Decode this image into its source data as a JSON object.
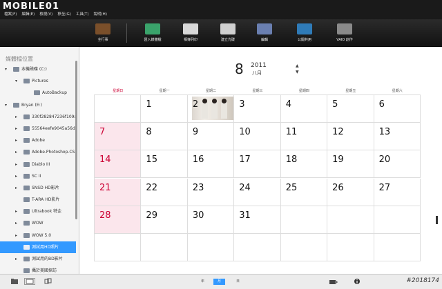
{
  "app": {
    "logo": "MOBILE01",
    "menu": [
      "檔案(F)",
      "編輯(E)",
      "檢視(V)",
      "移至(G)",
      "工具(T)",
      "說明(H)"
    ]
  },
  "toolbar": {
    "items": [
      {
        "label": "全行事",
        "icon": "calendar-view-icon",
        "color": "#7a4f2a"
      },
      {
        "label": "匯入媒體檔",
        "icon": "import-media-icon",
        "color": "#3aa36b"
      },
      {
        "label": "相簿列印",
        "icon": "printer-icon",
        "color": "#d8d8d8"
      },
      {
        "label": "建立光碟",
        "icon": "disc-icon",
        "color": "#cfcfcf"
      },
      {
        "label": "編輯",
        "icon": "edit-icon",
        "color": "#6a7fb0"
      },
      {
        "label": "公開共用",
        "icon": "globe-share-icon",
        "color": "#2f7bb8"
      },
      {
        "label": "VAIO 創作",
        "icon": "vaio-movie-icon",
        "color": "#8a8a8a"
      }
    ]
  },
  "sidebar": {
    "header": "媒體檔位置",
    "nodes": [
      {
        "label": "本機磁碟 (C:)",
        "depth": 0,
        "arrow": "▾",
        "selected": false
      },
      {
        "label": "Pictures",
        "depth": 1,
        "arrow": "▾",
        "selected": false
      },
      {
        "label": "AutoBackup",
        "depth": 2,
        "arrow": "",
        "selected": false
      },
      {
        "label": "Bryan (E:)",
        "depth": 0,
        "arrow": "▾",
        "selected": false
      },
      {
        "label": "330f282847236f109af",
        "depth": 1,
        "arrow": "▸",
        "selected": false
      },
      {
        "label": "55564eefe9045a56dd",
        "depth": 1,
        "arrow": "▸",
        "selected": false
      },
      {
        "label": "Adobe",
        "depth": 1,
        "arrow": "▸",
        "selected": false
      },
      {
        "label": "Adobe.Photoshop.CS3",
        "depth": 1,
        "arrow": "▸",
        "selected": false
      },
      {
        "label": "Diablo III",
        "depth": 1,
        "arrow": "▸",
        "selected": false
      },
      {
        "label": "SC II",
        "depth": 1,
        "arrow": "▸",
        "selected": false
      },
      {
        "label": "SNSD HD影片",
        "depth": 1,
        "arrow": "▸",
        "selected": false
      },
      {
        "label": "T-ARA HD影片",
        "depth": 1,
        "arrow": "",
        "selected": false
      },
      {
        "label": "Ultrabook 特企",
        "depth": 1,
        "arrow": "▸",
        "selected": false
      },
      {
        "label": "WOW",
        "depth": 1,
        "arrow": "▸",
        "selected": false
      },
      {
        "label": "WOW 5.0",
        "depth": 1,
        "arrow": "▸",
        "selected": false
      },
      {
        "label": "測試用HD照片",
        "depth": 1,
        "arrow": "",
        "selected": true
      },
      {
        "label": "測試用的BD影片",
        "depth": 1,
        "arrow": "▸",
        "selected": false
      },
      {
        "label": "攝於美國探訪",
        "depth": 1,
        "arrow": "",
        "selected": false
      }
    ]
  },
  "calendar": {
    "day": "8",
    "year": "2011",
    "month": "八月",
    "weekdays": [
      "星期日",
      "星期一",
      "星期二",
      "星期三",
      "星期四",
      "星期五",
      "星期六"
    ],
    "weeks": [
      [
        "",
        "1",
        "2",
        "3",
        "4",
        "5",
        "6"
      ],
      [
        "7",
        "8",
        "9",
        "10",
        "11",
        "12",
        "13"
      ],
      [
        "14",
        "15",
        "16",
        "17",
        "18",
        "19",
        "20"
      ],
      [
        "21",
        "22",
        "23",
        "24",
        "25",
        "26",
        "27"
      ],
      [
        "28",
        "29",
        "30",
        "31",
        "",
        "",
        ""
      ],
      [
        "",
        "",
        "",
        "",
        "",
        "",
        ""
      ]
    ],
    "photo_day": "2"
  },
  "status": {
    "view_year": "年",
    "view_month": "月",
    "view_day": "日",
    "watermark": "#2018174"
  },
  "colors": {
    "accent": "#3399ff",
    "sunday": "#cc0033",
    "sunday_bg": "#fbe6ec"
  }
}
